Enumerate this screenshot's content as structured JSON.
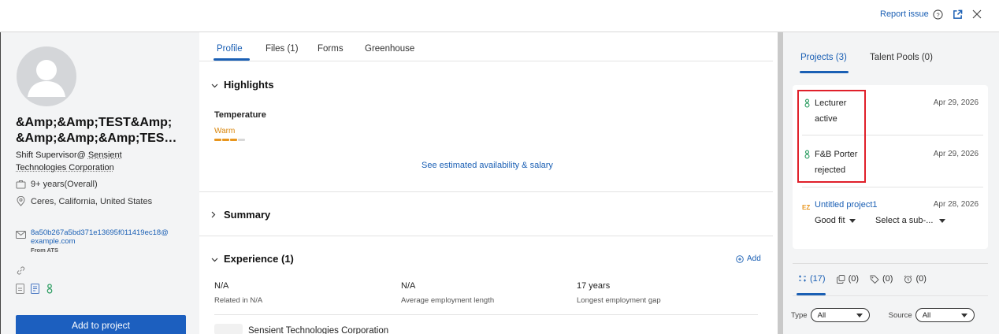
{
  "topbar": {
    "report_issue": "Report issue"
  },
  "candidate": {
    "name_line1": "&Amp;&Amp;TEST&Amp;",
    "name_line2": "&Amp;&Amp;&Amp;TES…",
    "role_prefix": "Shift Supervisor@ ",
    "company_part1": "Sensient",
    "company_part2": "Technologies Corporation",
    "experience": "9+ years(Overall)",
    "location": "Ceres, California, United States",
    "email_line1": "8a50b267a5bd371e13695f011419ec18@",
    "email_line2": "example.com",
    "email_source": "From ATS",
    "add_to_project": "Add to project"
  },
  "main": {
    "tabs": [
      {
        "label": "Profile"
      },
      {
        "label": "Files (1)"
      },
      {
        "label": "Forms"
      },
      {
        "label": "Greenhouse"
      }
    ],
    "highlights_title": "Highlights",
    "temperature_label": "Temperature",
    "temperature_value": "Warm",
    "temperature_level": 3,
    "availability_link": "See estimated availability & salary",
    "summary_title": "Summary",
    "experience_title": "Experience (1)",
    "add_label": "Add",
    "stats": [
      {
        "value": "N/A",
        "label": "Related in N/A"
      },
      {
        "value": "N/A",
        "label": "Average employment length"
      },
      {
        "value": "17 years",
        "label": "Longest employment gap"
      }
    ],
    "first_company": "Sensient Technologies Corporation"
  },
  "right": {
    "tabs": [
      {
        "label": "Projects (3)"
      },
      {
        "label": "Talent Pools (0)"
      }
    ],
    "projects": [
      {
        "name": "Lecturer",
        "status": "active",
        "date": "Apr 29, 2026"
      },
      {
        "name": "F&B Porter",
        "status": "rejected",
        "date": "Apr 29, 2026"
      },
      {
        "name": "Untitled project1",
        "fit": "Good fit",
        "stage": "Select a sub-...",
        "date": "Apr 28, 2026"
      }
    ],
    "counts": [
      "(17)",
      "(0)",
      "(0)",
      "(0)"
    ],
    "filter_type_label": "Type",
    "filter_type_value": "All",
    "filter_source_label": "Source",
    "filter_source_value": "All"
  },
  "colors": {
    "accent": "#1c5fbf",
    "highlight_box": "#e0202a",
    "warm": "#e8961e"
  }
}
